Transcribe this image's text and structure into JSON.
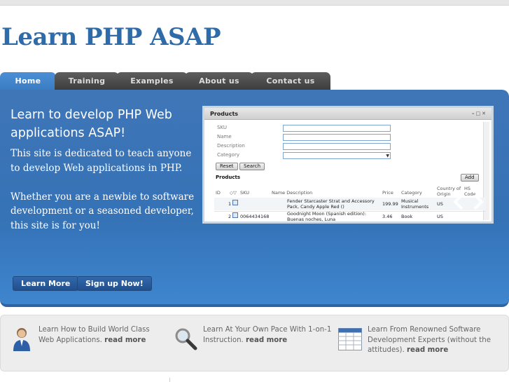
{
  "site": {
    "title": "Learn PHP ASAP"
  },
  "nav": {
    "tabs": [
      {
        "label": "Home",
        "active": true
      },
      {
        "label": "Training"
      },
      {
        "label": "Examples"
      },
      {
        "label": "About us"
      },
      {
        "label": "Contact us"
      }
    ]
  },
  "hero": {
    "title": "Learn to develop PHP Web applications ASAP!",
    "paragraph_1": "This site is dedicated to teach anyone to develop Web applications in PHP.",
    "paragraph_2": "Whether you are a newbie to software development or a seasoned developer, this site is for you!",
    "learn_more_label": "Learn More",
    "signup_label": "Sign up Now!"
  },
  "screenshot": {
    "window_title": "Products",
    "fields": [
      "SKU",
      "Name",
      "Description",
      "Category"
    ],
    "reset_label": "Reset",
    "search_label": "Search",
    "section_label": "Products",
    "add_label": "Add",
    "columns": [
      "ID",
      "SKU",
      "Name Description",
      "Price",
      "Category",
      "Country of Origin",
      "HS Code"
    ],
    "rows": [
      {
        "id": "1",
        "sku": "",
        "name": "Fender Starcaster Strat and Accessory Pack, Candy Apple Red ()",
        "price": "199.99",
        "category": "Musical Instruments",
        "country": "US"
      },
      {
        "id": "2",
        "sku": "0064434168",
        "name": "Goodnight Moon (Spanish edition): Buenas noches, Luna",
        "price": "3.46",
        "category": "Book",
        "country": "US"
      }
    ]
  },
  "features": [
    {
      "text": "Learn How to Build World Class Web Applications.",
      "link": "read more",
      "icon": "user-icon"
    },
    {
      "text": "Learn At Your Own Pace With 1-on-1 Instruction.",
      "link": "read more",
      "icon": "magnifier-icon"
    },
    {
      "text": "Learn From Renowned Software Development Experts (without the attitudes).",
      "link": "read more",
      "icon": "table-icon"
    }
  ],
  "colors": {
    "brand": "#2e6ba8",
    "hero": "#3572b6",
    "tab": "#4a4a4a"
  }
}
